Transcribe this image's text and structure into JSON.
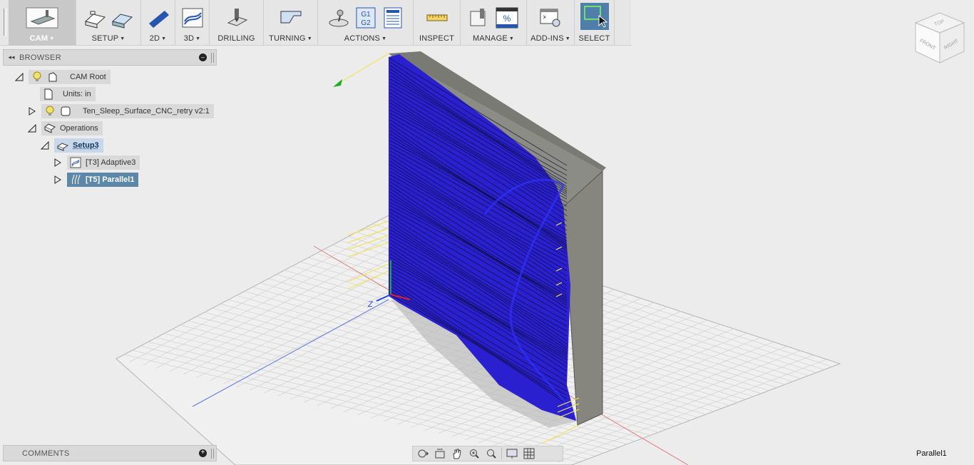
{
  "toolbar": {
    "cam": "CAM",
    "setup": "SETUP",
    "d2": "2D",
    "d3": "3D",
    "drilling": "DRILLING",
    "turning": "TURNING",
    "actions": "ACTIONS",
    "inspect": "INSPECT",
    "manage": "MANAGE",
    "addins": "ADD-INS",
    "select": "SELECT",
    "g1g2": [
      "G1",
      "G2"
    ],
    "percent": "%"
  },
  "browser": {
    "title": "BROWSER",
    "items": [
      {
        "label": "CAM Root"
      },
      {
        "label": "Units: in"
      },
      {
        "label": "Ten_Sleep_Surface_CNC_retry v2:1"
      },
      {
        "label": "Operations"
      },
      {
        "label": "Setup3"
      },
      {
        "label": "[T3] Adaptive3"
      },
      {
        "label": "[T5] Parallel1"
      }
    ]
  },
  "comments": {
    "title": "COMMENTS"
  },
  "status": {
    "active_operation": "Parallel1"
  },
  "viewcube": {
    "top": "TOP",
    "front": "FRONT",
    "right": "RIGHT"
  },
  "axis": {
    "z": "Z"
  },
  "colors": {
    "toolpath": "#1a10d8",
    "selection": "#5d87a8",
    "stock": "#8a8a82",
    "grid": "#c9c9c9"
  }
}
